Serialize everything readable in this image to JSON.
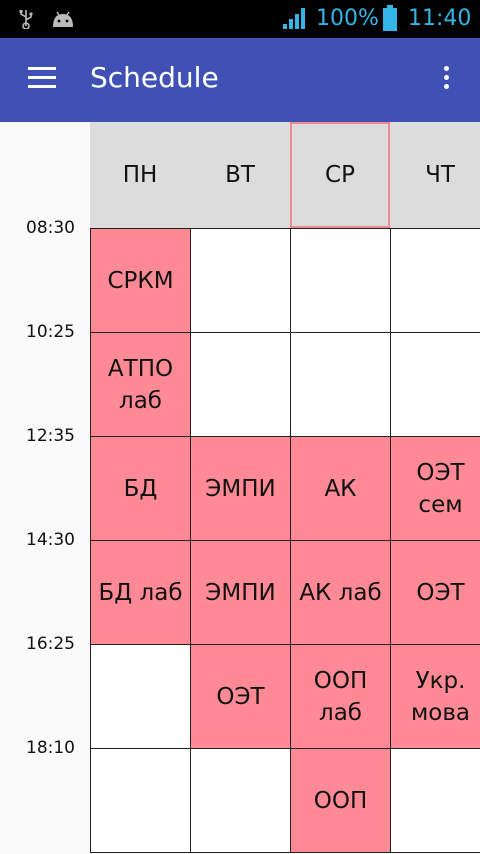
{
  "status_bar": {
    "battery_percent": "100%",
    "time": "11:40",
    "icons": [
      "usb-icon",
      "android-icon",
      "signal-icon",
      "battery-icon"
    ]
  },
  "app_bar": {
    "title": "Schedule"
  },
  "colors": {
    "app_bar": "#3f51b5",
    "cell_filled": "#ff8a96",
    "header_bg": "#dcdcdc",
    "today_border": "#f08a92",
    "status_text": "#33b5e5"
  },
  "days": [
    "ПН",
    "ВТ",
    "СР",
    "ЧТ"
  ],
  "today_index": 2,
  "times": [
    "08:30",
    "10:25",
    "12:35",
    "14:30",
    "16:25",
    "18:10"
  ],
  "rows": [
    [
      "СРКМ",
      "",
      "",
      ""
    ],
    [
      "АТПО лаб",
      "",
      "",
      ""
    ],
    [
      "БД",
      "ЭМПИ",
      "АК",
      "ОЭТ сем"
    ],
    [
      "БД лаб",
      "ЭМПИ",
      "АК лаб",
      "ОЭТ"
    ],
    [
      "",
      "ОЭТ",
      "ООП лаб",
      "Укр. мова"
    ],
    [
      "",
      "",
      "ООП",
      ""
    ]
  ]
}
